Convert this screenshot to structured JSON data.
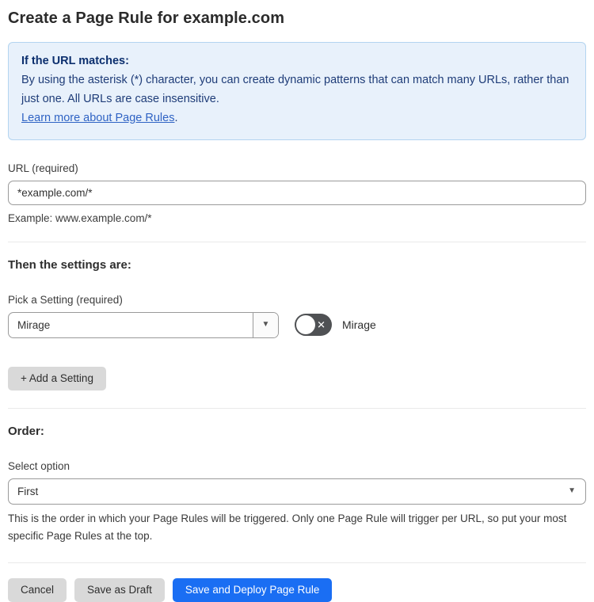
{
  "page": {
    "title": "Create a Page Rule for example.com"
  },
  "info_box": {
    "heading": "If the URL matches:",
    "body": "By using the asterisk (*) character, you can create dynamic patterns that can match many URLs, rather than just one. All URLs are case insensitive.",
    "link_label": "Learn more about Page Rules",
    "link_suffix": "."
  },
  "url_field": {
    "label": "URL (required)",
    "value": "*example.com/*",
    "example": "Example: www.example.com/*"
  },
  "settings": {
    "heading": "Then the settings are:",
    "picker_label": "Pick a Setting (required)",
    "picker_value": "Mirage",
    "toggle": {
      "label": "Mirage",
      "state": "off",
      "icon": "x-icon",
      "icon_glyph": "✕"
    },
    "add_button_label": "+ Add a Setting"
  },
  "order": {
    "heading": "Order:",
    "select_label": "Select option",
    "select_value": "First",
    "description": "This is the order in which your Page Rules will be triggered. Only one Page Rule will trigger per URL, so put your most specific Page Rules at the top."
  },
  "footer": {
    "cancel_label": "Cancel",
    "save_draft_label": "Save as Draft",
    "save_deploy_label": "Save and Deploy Page Rule"
  },
  "icons": {
    "dropdown_arrow": "▾"
  },
  "colors": {
    "primary_button": "#1a6ef3",
    "secondary_button": "#d9d9d9",
    "info_box_background": "#e8f1fb",
    "info_box_border": "#b3d4f0",
    "info_box_text": "#1e3c78",
    "info_box_heading": "#0c2f6e",
    "link": "#2f63c4",
    "toggle_off_background": "#4f5154",
    "input_border": "#9a9a9a",
    "divider": "#e9e9e9"
  }
}
